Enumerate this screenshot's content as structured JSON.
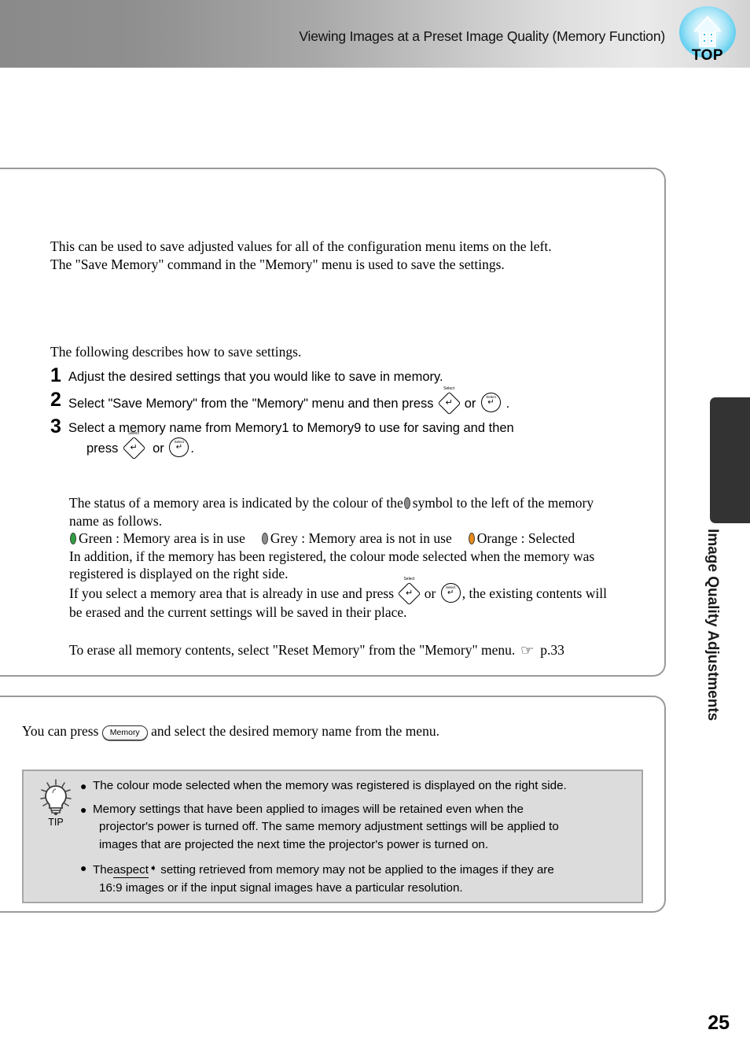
{
  "header": {
    "title": "Viewing Images at a Preset Image Quality (Memory Function)",
    "top_icon_label": "TOP",
    "top_icon_name": "home-top-icon"
  },
  "main": {
    "intro_line1": "This can be used to save adjusted values for all of the configuration menu items on the left.",
    "intro_line2": "The \"Save Memory\" command in the \"Memory\" menu is used to save the settings.",
    "follow_text": "The following describes how to save settings.",
    "steps": [
      {
        "number": "1",
        "text": "Adjust the desired settings that you would like to save in memory."
      },
      {
        "number": "2",
        "text_before": "Select \"Save Memory\" from the \"Memory\" menu and then press",
        "conjunction": "or",
        "text_after": "."
      },
      {
        "number": "3",
        "text_line1": "Select a memory name from Memory1 to Memory9 to use for saving and then",
        "press_label": "press",
        "conjunction": "or",
        "text_after": "."
      }
    ],
    "status": {
      "line1": "The status of a memory area is indicated by the colour of the",
      "line1_cont": "symbol to the left of the memory",
      "line2": "name as follows.",
      "legend": [
        {
          "label": "Green : Memory area is in use",
          "colour": "#2f9e3f"
        },
        {
          "label": "Grey : Memory area is not in use",
          "colour": "#8e8e8e"
        },
        {
          "label": "Orange : Selected",
          "colour": "#e88a1a"
        }
      ],
      "line3": "In addition, if the memory has been registered, the colour mode selected when the memory was",
      "line4": "registered is displayed on the right side.",
      "line5_before": "If you select a memory area that is already in use and press",
      "line5_conjunction": "or",
      "line5_after": ", the existing contents will",
      "line6": "be erased and the current settings will be saved in their place."
    },
    "erase": {
      "text": "To erase all memory contents, select \"Reset Memory\" from the \"Memory\" menu.",
      "ref_icon": "☞",
      "ref_page": "p.33"
    }
  },
  "note_box": {
    "text_before": "You can press",
    "button_label": "Memory",
    "text_after": "and select the desired memory name from the menu."
  },
  "tip": {
    "label": "TIP",
    "items": [
      {
        "text": "The colour mode selected when the memory was registered is displayed on the right side."
      },
      {
        "text": "Memory settings that have been applied to images will be retained even when the",
        "sub1": "projector's power is turned off. The same memory adjustment settings will be applied to",
        "sub2": "images that are projected the next time the projector's power is turned on."
      },
      {
        "text_before": "The",
        "term": "aspect",
        "text_after": "setting retrieved from memory may not be applied to the images if they are",
        "sub1": "16:9 images or if the input signal images have a particular resolution."
      }
    ]
  },
  "side_tab": {
    "label": "Image Quality Adjustments"
  },
  "footer": {
    "page_number": "25"
  },
  "button_glyphs": {
    "select_caption": "Select",
    "enter_arrow": "↵"
  },
  "colors": {
    "header_gradient_start": "#8a8a8a",
    "header_gradient_end": "#d2d2d2",
    "box_border": "#9a9a9a",
    "tip_background": "#dcdcdc",
    "tip_border": "#a6a6a6",
    "side_tab": "#333333",
    "top_icon_blue": "#64cff0"
  }
}
